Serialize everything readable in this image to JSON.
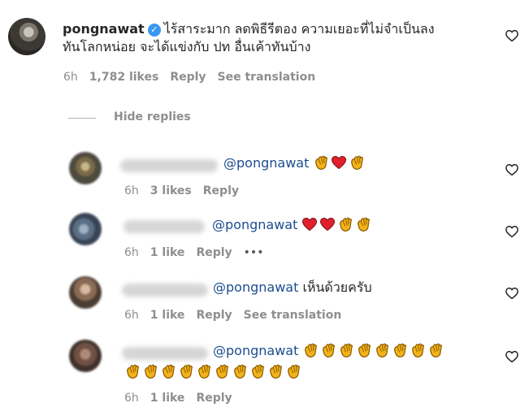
{
  "main_comment": {
    "username": "pongnawat",
    "text_line1": "ไร้สาระมาก ลดพิธีรีตอง ความเยอะที่ไม่จำเป็นลง",
    "text_line2": "ทันโลกหน่อย จะได้แข่งกับ ปท อื่นเค้าทันบ้าง",
    "time": "6h",
    "likes": "1,782 likes",
    "reply_label": "Reply",
    "translation_label": "See translation"
  },
  "hide_replies_label": "Hide replies",
  "replies": [
    {
      "mention": "@pongnawat",
      "emojis": [
        "clap",
        "heart",
        "clap"
      ],
      "time": "6h",
      "likes": "3 likes",
      "reply_label": "Reply"
    },
    {
      "mention": "@pongnawat",
      "emojis": [
        "heart",
        "heart",
        "clap",
        "clap"
      ],
      "time": "6h",
      "likes": "1 like",
      "reply_label": "Reply",
      "more_label": "•••"
    },
    {
      "mention": "@pongnawat",
      "text": "เห็นด้วยครับ",
      "time": "6h",
      "likes": "1 like",
      "reply_label": "Reply",
      "translation_label": "See translation"
    },
    {
      "mention": "@pongnawat",
      "emojis": [
        "clap",
        "clap",
        "clap",
        "clap",
        "clap",
        "clap",
        "clap",
        "clap"
      ],
      "emojis_line2": [
        "clap",
        "clap",
        "clap",
        "clap",
        "clap",
        "clap",
        "clap",
        "clap",
        "clap",
        "clap"
      ],
      "time": "6h",
      "likes": "1 like",
      "reply_label": "Reply"
    }
  ],
  "icons": {
    "heart_outline": "heart-icon",
    "verified": "verified-badge-icon",
    "clap": "clapping-hands-emoji",
    "red_heart": "red-heart-emoji"
  },
  "colors": {
    "mention": "#1d4d8f",
    "meta": "#8e8e8e",
    "verified": "#3897f0",
    "emoji_heart": "#e0202e",
    "emoji_clap": "#f2b500"
  }
}
